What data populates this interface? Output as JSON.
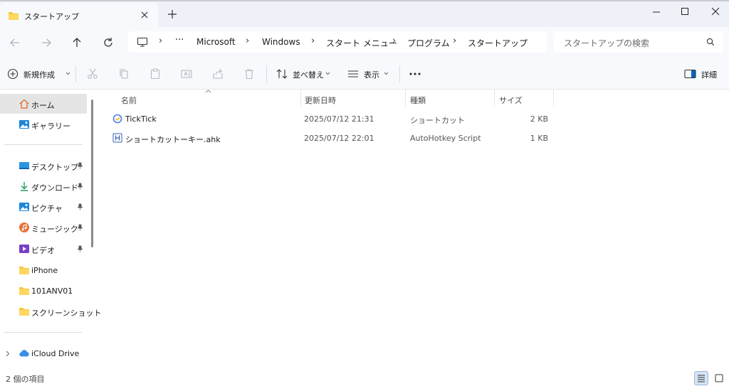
{
  "tab": {
    "title": "スタートアップ"
  },
  "breadcrumb": [
    "Microsoft",
    "Windows",
    "スタート メニュー",
    "プログラム",
    "スタートアップ"
  ],
  "search": {
    "placeholder": "スタートアップの検索"
  },
  "toolbar": {
    "new_label": "新規作成",
    "sort_label": "並べ替え",
    "view_label": "表示",
    "details_label": "詳細"
  },
  "sidebar": {
    "top": [
      {
        "label": "ホーム",
        "icon": "home-icon"
      },
      {
        "label": "ギャラリー",
        "icon": "gallery-icon"
      }
    ],
    "pinned": [
      {
        "label": "デスクトップ",
        "icon": "desktop-icon"
      },
      {
        "label": "ダウンロード",
        "icon": "download-icon"
      },
      {
        "label": "ピクチャ",
        "icon": "pictures-icon"
      },
      {
        "label": "ミュージック",
        "icon": "music-icon"
      },
      {
        "label": "ビデオ",
        "icon": "video-icon"
      }
    ],
    "folders": [
      {
        "label": "iPhone",
        "icon": "folder-icon"
      },
      {
        "label": "101ANV01",
        "icon": "folder-icon"
      },
      {
        "label": "スクリーンショット",
        "icon": "folder-icon"
      }
    ],
    "cloud": [
      {
        "label": "iCloud Drive",
        "icon": "icloud-icon"
      }
    ]
  },
  "columns": {
    "name": "名前",
    "date": "更新日時",
    "type": "種類",
    "size": "サイズ"
  },
  "files": [
    {
      "name": "TickTick",
      "date": "2025/07/12 21:31",
      "type": "ショートカット",
      "size": "2 KB",
      "icon": "shortcut-icon"
    },
    {
      "name": "ショートカットーキー.ahk",
      "date": "2025/07/12 22:01",
      "type": "AutoHotkey Script",
      "size": "1 KB",
      "icon": "ahk-file-icon"
    }
  ],
  "status": {
    "item_count": "2 個の項目"
  },
  "colors": {
    "accent": "#0067c0",
    "folder": "#f8c73e",
    "chrome": "#f7f9fc"
  }
}
